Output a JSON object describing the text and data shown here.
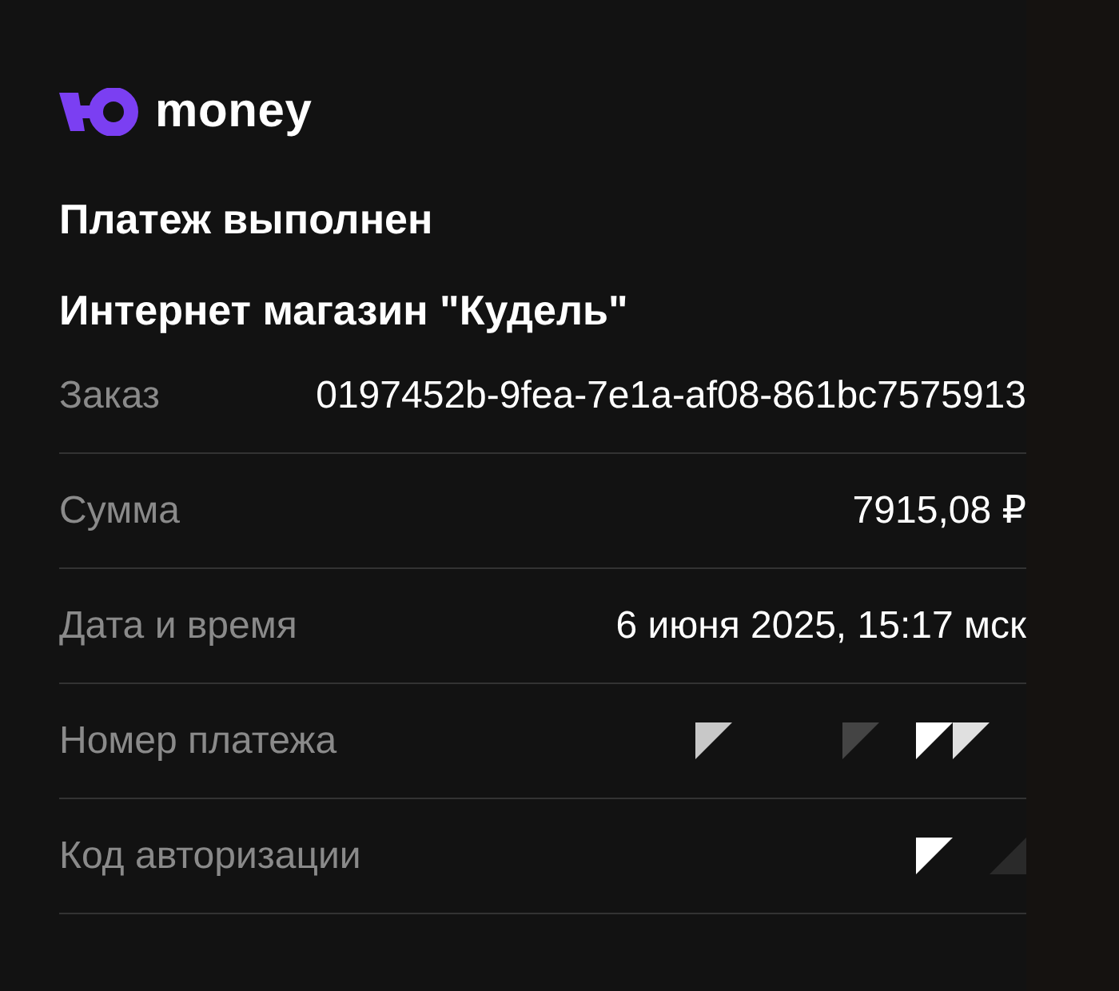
{
  "brand": {
    "name": "money"
  },
  "status": "Платеж выполнен",
  "merchant": "Интернет магазин \"Кудель\"",
  "details": [
    {
      "kind": "text",
      "label": "Заказ",
      "value": "0197452b-9fea-7e1a-af08-861bc7575913"
    },
    {
      "kind": "text",
      "label": "Сумма",
      "value": "7915,08 ₽"
    },
    {
      "kind": "text",
      "label": "Дата и время",
      "value": "6 июня 2025, 15:17 мск"
    },
    {
      "kind": "masked",
      "label": "Номер платежа"
    },
    {
      "kind": "masked",
      "label": "Код авторизации"
    }
  ]
}
